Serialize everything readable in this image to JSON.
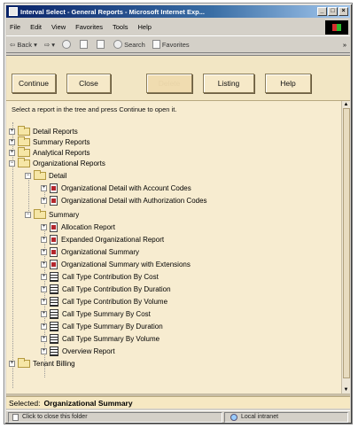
{
  "window": {
    "title": "Interval Select - General Reports - Microsoft Internet Exp...",
    "controls": [
      "_",
      "□",
      "×"
    ]
  },
  "menu": [
    "File",
    "Edit",
    "View",
    "Favorites",
    "Tools",
    "Help"
  ],
  "toolbar": {
    "back": "Back",
    "search": "Search",
    "favorites": "Favorites",
    "more": "»"
  },
  "buttons": {
    "continue": "Continue",
    "close": "Close",
    "disabled": "Delete",
    "listing": "Listing",
    "help": "Help"
  },
  "instruction": "Select a report in the tree and press Continue to open it.",
  "tree": {
    "detail_reports": "Detail Reports",
    "summary_reports": "Summary Reports",
    "analytical_reports": "Analytical Reports",
    "organizational_reports": "Organizational Reports",
    "detail": "Detail",
    "org_detail_account": "Organizational Detail with Account Codes",
    "org_detail_auth": "Organizational Detail with Authorization Codes",
    "summary": "Summary",
    "allocation_report": "Allocation Report",
    "expanded_org_report": "Expanded Organizational Report",
    "org_summary": "Organizational Summary",
    "org_summary_ext": "Organizational Summary with Extensions",
    "ct_contrib_cost": "Call Type Contribution By Cost",
    "ct_contrib_duration": "Call Type Contribution By Duration",
    "ct_contrib_volume": "Call Type Contribution By Volume",
    "ct_summary_cost": "Call Type Summary By Cost",
    "ct_summary_duration": "Call Type Summary By Duration",
    "ct_summary_volume": "Call Type Summary By Volume",
    "overview_report": "Overview Report",
    "tenant_billing": "Tenant Billing"
  },
  "selection": {
    "label": "Selected:",
    "value": "Organizational Summary"
  },
  "status": {
    "message": "Click to close this folder",
    "zone": "Local intranet"
  }
}
